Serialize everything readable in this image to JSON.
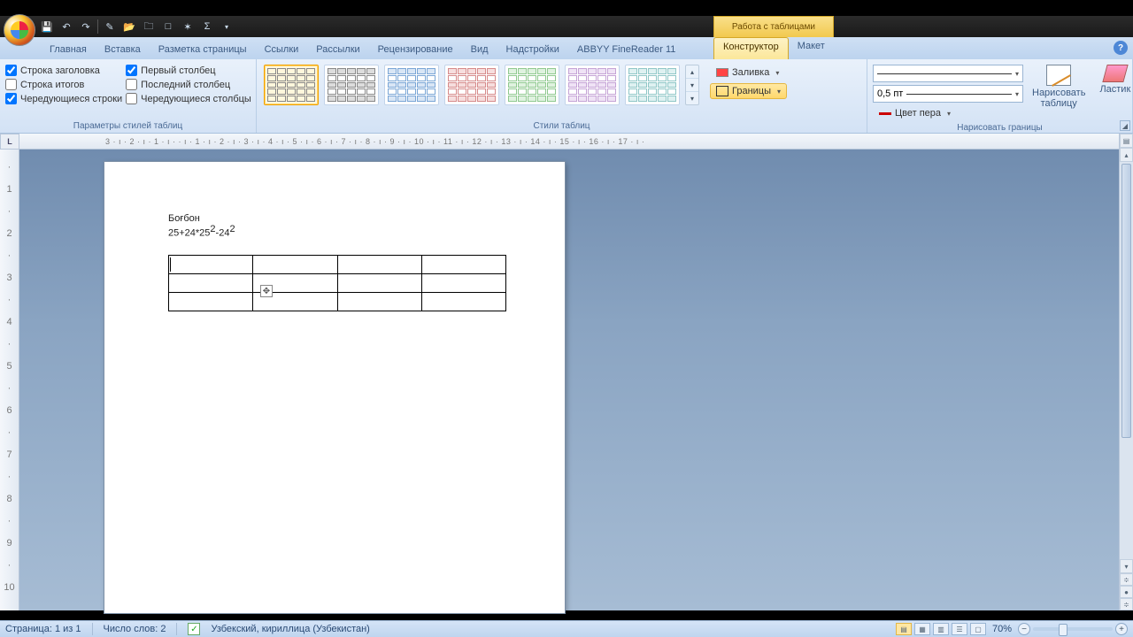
{
  "context_header": "Работа с таблицами",
  "tabs": [
    "Главная",
    "Вставка",
    "Разметка страницы",
    "Ссылки",
    "Рассылки",
    "Рецензирование",
    "Вид",
    "Надстройки",
    "ABBYY FineReader 11"
  ],
  "context_tabs": {
    "design": "Конструктор",
    "layout": "Макет"
  },
  "ribbon": {
    "options": {
      "header_row": "Строка заголовка",
      "total_row": "Строка итогов",
      "banded_rows": "Чередующиеся строки",
      "first_col": "Первый столбец",
      "last_col": "Последний столбец",
      "banded_cols": "Чередующиеся столбцы",
      "group_title": "Параметры стилей таблиц"
    },
    "styles_group": "Стили таблиц",
    "shading": "Заливка",
    "borders": "Границы",
    "pen_weight": "0,5 пт",
    "pen_color": "Цвет пера",
    "draw_table": "Нарисовать\nтаблицу",
    "eraser": "Ластик",
    "draw_group": "Нарисовать границы"
  },
  "ruler_h": "3 · ı · 2 · ı · 1 · ı ·   · ı · 1 · ı · 2 · ı · 3 · ı · 4 · ı · 5 · ı · 6 · ı · 7 · ı · 8 · ı · 9 · ı · 10 · ı · 11 · ı · 12 · ı · 13 · ı · 14 · ı · 15 · ı · 16 · ı · 17 · ı ·",
  "document": {
    "line1": "Боғбон",
    "formula_a": "25+24*25",
    "formula_b": "-24",
    "sup": "2"
  },
  "status": {
    "page": "Страница: 1 из 1",
    "words": "Число слов: 2",
    "lang": "Узбекский, кириллица (Узбекистан)",
    "zoom": "70%"
  }
}
